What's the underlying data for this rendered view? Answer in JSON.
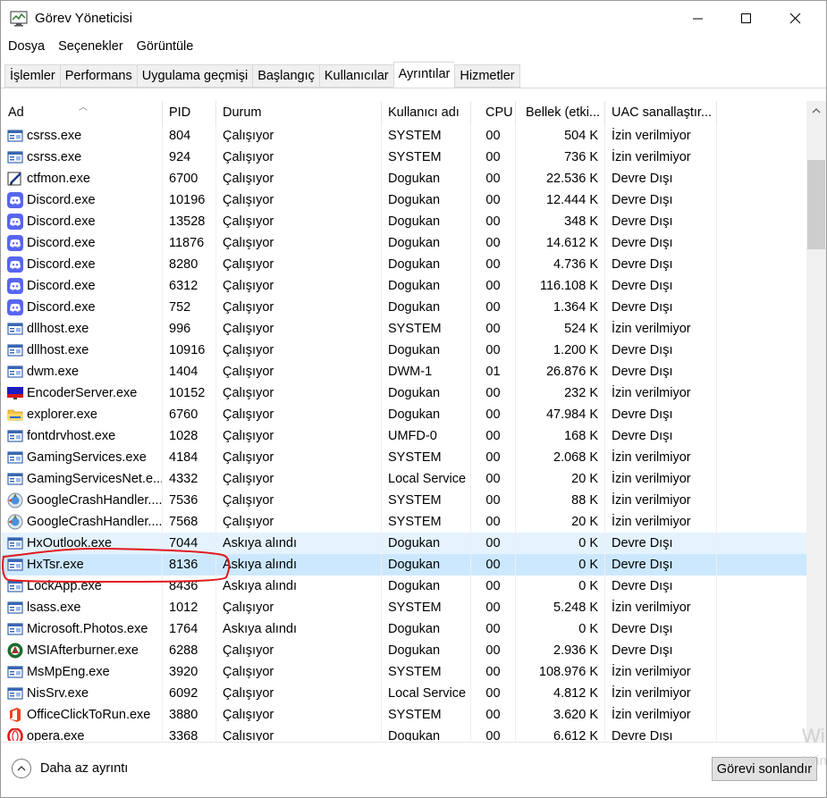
{
  "window": {
    "title": "Görev Yöneticisi"
  },
  "menu": [
    "Dosya",
    "Seçenekler",
    "Görüntüle"
  ],
  "tabs": [
    "İşlemler",
    "Performans",
    "Uygulama geçmişi",
    "Başlangıç",
    "Kullanıcılar",
    "Ayrıntılar",
    "Hizmetler"
  ],
  "active_tab": "Ayrıntılar",
  "columns": [
    "Ad",
    "PID",
    "Durum",
    "Kullanıcı adı",
    "CPU",
    "Bellek (etki...",
    "UAC sanallaştır..."
  ],
  "rows": [
    {
      "name": "csrss.exe",
      "pid": "804",
      "status": "Çalışıyor",
      "user": "SYSTEM",
      "cpu": "00",
      "mem": "504 K",
      "uac": "İzin verilmiyor",
      "icon": "system-window-icon"
    },
    {
      "name": "csrss.exe",
      "pid": "924",
      "status": "Çalışıyor",
      "user": "SYSTEM",
      "cpu": "00",
      "mem": "736 K",
      "uac": "İzin verilmiyor",
      "icon": "system-window-icon"
    },
    {
      "name": "ctfmon.exe",
      "pid": "6700",
      "status": "Çalışıyor",
      "user": "Dogukan",
      "cpu": "00",
      "mem": "22.536 K",
      "uac": "Devre Dışı",
      "icon": "pen-notepad-icon"
    },
    {
      "name": "Discord.exe",
      "pid": "10196",
      "status": "Çalışıyor",
      "user": "Dogukan",
      "cpu": "00",
      "mem": "12.444 K",
      "uac": "Devre Dışı",
      "icon": "discord-icon"
    },
    {
      "name": "Discord.exe",
      "pid": "13528",
      "status": "Çalışıyor",
      "user": "Dogukan",
      "cpu": "00",
      "mem": "348 K",
      "uac": "Devre Dışı",
      "icon": "discord-icon"
    },
    {
      "name": "Discord.exe",
      "pid": "11876",
      "status": "Çalışıyor",
      "user": "Dogukan",
      "cpu": "00",
      "mem": "14.612 K",
      "uac": "Devre Dışı",
      "icon": "discord-icon"
    },
    {
      "name": "Discord.exe",
      "pid": "8280",
      "status": "Çalışıyor",
      "user": "Dogukan",
      "cpu": "00",
      "mem": "4.736 K",
      "uac": "Devre Dışı",
      "icon": "discord-icon"
    },
    {
      "name": "Discord.exe",
      "pid": "6312",
      "status": "Çalışıyor",
      "user": "Dogukan",
      "cpu": "00",
      "mem": "116.108 K",
      "uac": "Devre Dışı",
      "icon": "discord-icon"
    },
    {
      "name": "Discord.exe",
      "pid": "752",
      "status": "Çalışıyor",
      "user": "Dogukan",
      "cpu": "00",
      "mem": "1.364 K",
      "uac": "Devre Dışı",
      "icon": "discord-icon"
    },
    {
      "name": "dllhost.exe",
      "pid": "996",
      "status": "Çalışıyor",
      "user": "SYSTEM",
      "cpu": "00",
      "mem": "524 K",
      "uac": "İzin verilmiyor",
      "icon": "system-window-icon"
    },
    {
      "name": "dllhost.exe",
      "pid": "10916",
      "status": "Çalışıyor",
      "user": "Dogukan",
      "cpu": "00",
      "mem": "1.200 K",
      "uac": "Devre Dışı",
      "icon": "system-window-icon"
    },
    {
      "name": "dwm.exe",
      "pid": "1404",
      "status": "Çalışıyor",
      "user": "DWM-1",
      "cpu": "01",
      "mem": "26.876 K",
      "uac": "Devre Dışı",
      "icon": "system-window-icon"
    },
    {
      "name": "EncoderServer.exe",
      "pid": "10152",
      "status": "Çalışıyor",
      "user": "Dogukan",
      "cpu": "00",
      "mem": "232 K",
      "uac": "İzin verilmiyor",
      "icon": "encoder-icon"
    },
    {
      "name": "explorer.exe",
      "pid": "6760",
      "status": "Çalışıyor",
      "user": "Dogukan",
      "cpu": "00",
      "mem": "47.984 K",
      "uac": "Devre Dışı",
      "icon": "folder-icon"
    },
    {
      "name": "fontdrvhost.exe",
      "pid": "1028",
      "status": "Çalışıyor",
      "user": "UMFD-0",
      "cpu": "00",
      "mem": "168 K",
      "uac": "Devre Dışı",
      "icon": "system-window-icon"
    },
    {
      "name": "GamingServices.exe",
      "pid": "4184",
      "status": "Çalışıyor",
      "user": "SYSTEM",
      "cpu": "00",
      "mem": "2.068 K",
      "uac": "İzin verilmiyor",
      "icon": "system-window-icon"
    },
    {
      "name": "GamingServicesNet.e...",
      "pid": "4332",
      "status": "Çalışıyor",
      "user": "Local Service",
      "cpu": "00",
      "mem": "20 K",
      "uac": "İzin verilmiyor",
      "icon": "system-window-icon"
    },
    {
      "name": "GoogleCrashHandler....",
      "pid": "7536",
      "status": "Çalışıyor",
      "user": "SYSTEM",
      "cpu": "00",
      "mem": "88 K",
      "uac": "İzin verilmiyor",
      "icon": "google-update-icon"
    },
    {
      "name": "GoogleCrashHandler....",
      "pid": "7568",
      "status": "Çalışıyor",
      "user": "SYSTEM",
      "cpu": "00",
      "mem": "20 K",
      "uac": "İzin verilmiyor",
      "icon": "google-update-icon"
    },
    {
      "name": "HxOutlook.exe",
      "pid": "7044",
      "status": "Askıya alındı",
      "user": "Dogukan",
      "cpu": "00",
      "mem": "0 K",
      "uac": "Devre Dışı",
      "icon": "system-window-icon",
      "highlight": "hover"
    },
    {
      "name": "HxTsr.exe",
      "pid": "8136",
      "status": "Askıya alındı",
      "user": "Dogukan",
      "cpu": "00",
      "mem": "0 K",
      "uac": "Devre Dışı",
      "icon": "system-window-icon",
      "highlight": "selected"
    },
    {
      "name": "LockApp.exe",
      "pid": "8436",
      "status": "Askıya alındı",
      "user": "Dogukan",
      "cpu": "00",
      "mem": "0 K",
      "uac": "Devre Dışı",
      "icon": "system-window-icon"
    },
    {
      "name": "lsass.exe",
      "pid": "1012",
      "status": "Çalışıyor",
      "user": "SYSTEM",
      "cpu": "00",
      "mem": "5.248 K",
      "uac": "İzin verilmiyor",
      "icon": "system-window-icon"
    },
    {
      "name": "Microsoft.Photos.exe",
      "pid": "1764",
      "status": "Askıya alındı",
      "user": "Dogukan",
      "cpu": "00",
      "mem": "0 K",
      "uac": "Devre Dışı",
      "icon": "system-window-icon"
    },
    {
      "name": "MSIAfterburner.exe",
      "pid": "6288",
      "status": "Çalışıyor",
      "user": "Dogukan",
      "cpu": "00",
      "mem": "2.936 K",
      "uac": "Devre Dışı",
      "icon": "afterburner-icon"
    },
    {
      "name": "MsMpEng.exe",
      "pid": "3920",
      "status": "Çalışıyor",
      "user": "SYSTEM",
      "cpu": "00",
      "mem": "108.976 K",
      "uac": "İzin verilmiyor",
      "icon": "system-window-icon"
    },
    {
      "name": "NisSrv.exe",
      "pid": "6092",
      "status": "Çalışıyor",
      "user": "Local Service",
      "cpu": "00",
      "mem": "4.812 K",
      "uac": "İzin verilmiyor",
      "icon": "system-window-icon"
    },
    {
      "name": "OfficeClickToRun.exe",
      "pid": "3880",
      "status": "Çalışıyor",
      "user": "SYSTEM",
      "cpu": "00",
      "mem": "3.620 K",
      "uac": "İzin verilmiyor",
      "icon": "office-icon"
    },
    {
      "name": "opera.exe",
      "pid": "3368",
      "status": "Çalışıyor",
      "user": "Dogukan",
      "cpu": "00",
      "mem": "6.612 K",
      "uac": "Devre Dışı",
      "icon": "opera-icon"
    }
  ],
  "footer": {
    "fewer_details": "Daha az ayrıntı",
    "end_task": "Görevi sonlandır"
  },
  "watermark": "Wi",
  "watermark2": "Win",
  "colors": {
    "hover_row": "#e5f3ff",
    "selected_row": "#cce8ff",
    "annotation": "#e0191e",
    "discord": "#5865f2"
  }
}
